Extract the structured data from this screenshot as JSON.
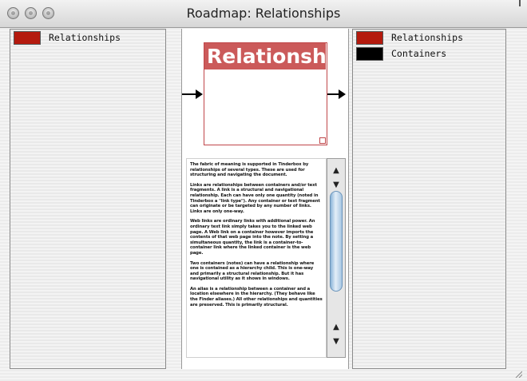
{
  "window": {
    "title": "Roadmap: Relationships"
  },
  "left_pane": {
    "items": [
      {
        "label": "Relationships",
        "color": "#b41a0e"
      }
    ]
  },
  "right_pane": {
    "items": [
      {
        "label": "Relationships",
        "color": "#b41a0e"
      },
      {
        "label": "Containers",
        "color": "#000000"
      }
    ]
  },
  "canvas": {
    "node": {
      "title": "Relationshi",
      "color": "#cb5a5a"
    }
  },
  "text_panel": {
    "paragraphs": [
      "The fabric of meaning is supported in Tinderbox by relationships of several types. These are used for structuring and navigating the document.",
      "Links are relationships between containers and/or text fragments. A link is a structural and navigational relationship. Each can have only one quantity (noted in Tinderbox a \"link type\"). Any container or text fragment can originate or be targeted by any number of links. Links are only one-way.",
      "Web links are ordinary links with additional power. An ordinary text link simply takes you to the linked web page. A Web link on a container however imports the contents of that web page into the note. By setting a simultaneous quantity, the link is a container-to-container link where the linked container is the web page.",
      "Two containers (notes) can have a relationship where one is contained as a hierarchy child. This is one-way and primarily a structural relationship. But it has navigational utility as it shows in windows.",
      "An alias is a relationship between a container and a location elsewhere in the hierarchy. (They behave like the Finder aliases.) All other relationships and quantities are preserved. This is primarily structural."
    ]
  }
}
